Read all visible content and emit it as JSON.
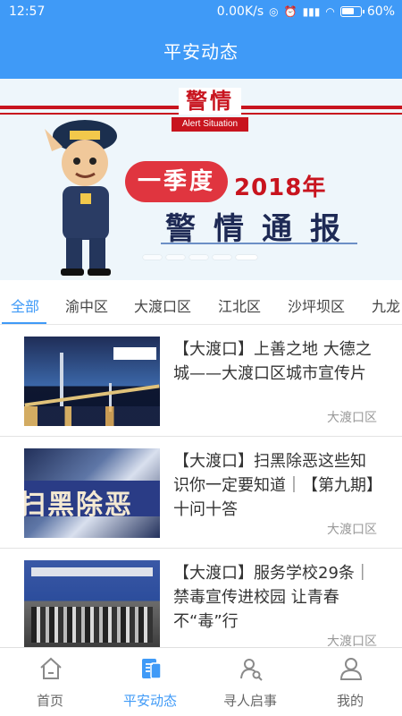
{
  "status_bar": {
    "time": "12:57",
    "network_speed": "0.00K/s",
    "battery_percent": "60%",
    "icons": [
      "nfc-icon",
      "alarm-icon",
      "signal-icon",
      "wifi-icon",
      "battery-icon"
    ]
  },
  "header": {
    "title": "平安动态"
  },
  "banner": {
    "heading": "警情",
    "heading_en": "Alert Situation",
    "quarter": "一季度",
    "year": "2018年",
    "subtitle": "警情通报",
    "slide_count": 5,
    "active_slide": 5
  },
  "tabs": [
    {
      "label": "全部",
      "active": true
    },
    {
      "label": "渝中区",
      "active": false
    },
    {
      "label": "大渡口区",
      "active": false
    },
    {
      "label": "江北区",
      "active": false
    },
    {
      "label": "沙坪坝区",
      "active": false
    },
    {
      "label": "九龙",
      "active": false
    }
  ],
  "news": [
    {
      "title": "【大渡口】上善之地 大德之城——大渡口区城市宣传片",
      "source": "大渡口区",
      "thumb": "bridge-night"
    },
    {
      "title": "【大渡口】扫黑除恶这些知识你一定要知道｜【第九期】十问十答",
      "thumb_text": "扫黑除恶",
      "source": "大渡口区",
      "thumb": "anti-crime-poster"
    },
    {
      "title": "【大渡口】服务学校29条｜禁毒宣传进校园 让青春不“毒”行",
      "source": "大渡口区",
      "thumb": "school-stage"
    }
  ],
  "bottom_nav": [
    {
      "label": "首页",
      "icon": "home-icon",
      "active": false
    },
    {
      "label": "平安动态",
      "icon": "news-icon",
      "active": true
    },
    {
      "label": "寻人启事",
      "icon": "people-search-icon",
      "active": false
    },
    {
      "label": "我的",
      "icon": "user-icon",
      "active": false
    }
  ],
  "colors": {
    "primary": "#3f9af7",
    "banner_red": "#c8141e",
    "text": "#333333",
    "muted": "#999999"
  }
}
